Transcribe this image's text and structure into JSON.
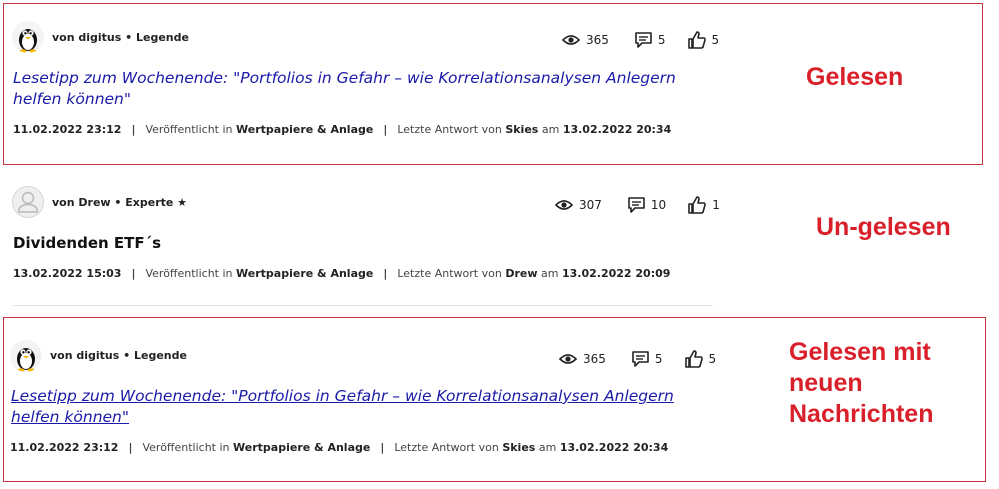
{
  "posts": [
    {
      "author": "von digitus • Legende",
      "views": "365",
      "comments": "5",
      "likes": "5",
      "title": "Lesetipp zum Wochenende: \"Portfolios in Gefahr – wie Korrelationsanalysen Anlegern helfen können\"",
      "date": "11.02.2022 23:12",
      "published_prefix": "Veröffentlicht in",
      "board": "Wertpapiere & Anlage",
      "last_reply_prefix": "Letzte Antwort von",
      "last_reply_user": "Skies",
      "last_reply_on": "am",
      "last_reply_date": "13.02.2022 20:34",
      "annotation": "Gelesen"
    },
    {
      "author": "von Drew • Experte ★",
      "views": "307",
      "comments": "10",
      "likes": "1",
      "title": "Dividenden ETF´s",
      "date": "13.02.2022 15:03",
      "published_prefix": "Veröffentlicht in",
      "board": "Wertpapiere & Anlage",
      "last_reply_prefix": "Letzte Antwort von",
      "last_reply_user": "Drew",
      "last_reply_on": "am",
      "last_reply_date": "13.02.2022 20:09",
      "annotation": "Un-gelesen"
    },
    {
      "author": "von digitus • Legende",
      "views": "365",
      "comments": "5",
      "likes": "5",
      "title": "Lesetipp zum Wochenende: \"Portfolios in Gefahr – wie Korrelationsanalysen Anlegern helfen können\"",
      "date": "11.02.2022 23:12",
      "published_prefix": "Veröffentlicht in",
      "board": "Wertpapiere & Anlage",
      "last_reply_prefix": "Letzte Antwort von",
      "last_reply_user": "Skies",
      "last_reply_on": "am",
      "last_reply_date": "13.02.2022 20:34",
      "annotation": "Gelesen mit neuen Nachrichten"
    }
  ],
  "sep": "|",
  "colors": {
    "annotation": "#d9202a",
    "frame": "#c8323c",
    "link": "#1a1aa8"
  },
  "icons": {
    "views": "eye-icon",
    "comments": "comment-icon",
    "likes": "thumbs-up-icon"
  }
}
